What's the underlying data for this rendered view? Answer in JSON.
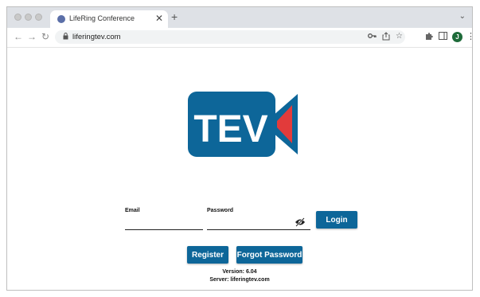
{
  "browser": {
    "tab": {
      "title": "LifeRing Conference",
      "favicon": "globe-icon",
      "close_glyph": "✕"
    },
    "new_tab_glyph": "+",
    "tab_menu_glyph": "⌄",
    "nav": {
      "back_glyph": "←",
      "forward_glyph": "→",
      "reload_glyph": "↻"
    },
    "url": "liferingtev.com",
    "lock_glyph": "🔒",
    "toolbar_icons": [
      "key-icon",
      "share-icon",
      "star-icon",
      "extensions-icon",
      "sidebar-icon"
    ],
    "profile_initial": "J",
    "profile_color": "#1e6b3a",
    "menu_glyph": "⋮"
  },
  "logo": {
    "text": "TEV",
    "bg_color": "#0d6699",
    "accent_color": "#e23b3b"
  },
  "form": {
    "email_label": "Email",
    "email_value": "",
    "password_label": "Password",
    "password_value": "",
    "login_label": "Login",
    "register_label": "Register",
    "forgot_label": "Forgot Password"
  },
  "footer": {
    "version": "Version: 6.04",
    "server": "Server: liferingtev.com"
  },
  "colors": {
    "button": "#0d6699",
    "tabbar": "#dee1e6"
  }
}
